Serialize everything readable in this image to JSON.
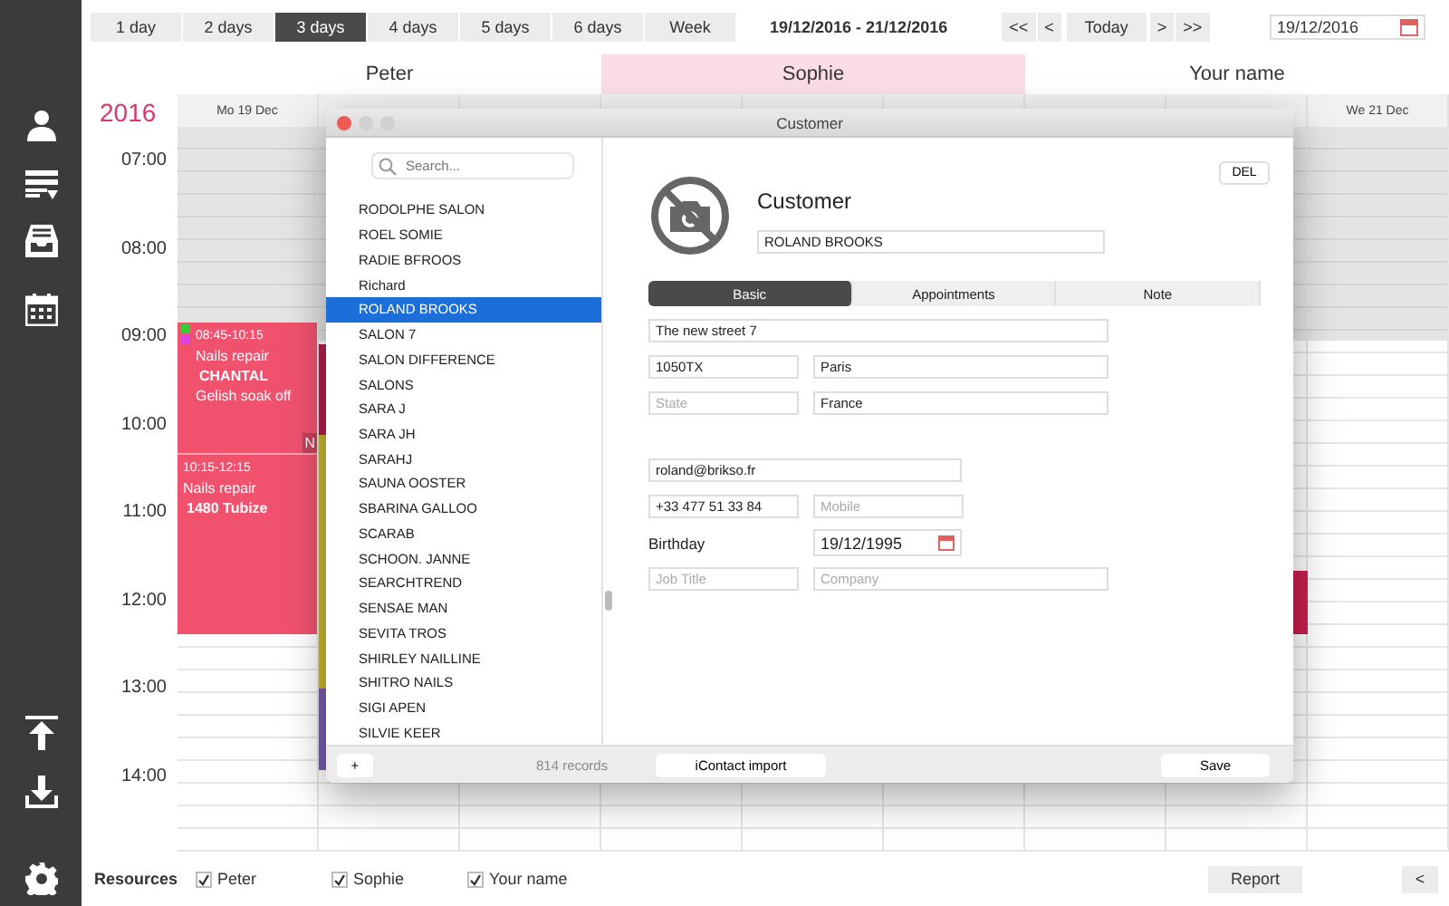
{
  "toolbar": {
    "ranges": [
      {
        "label": "1 day",
        "selected": false
      },
      {
        "label": "2 days",
        "selected": false
      },
      {
        "label": "3 days",
        "selected": true
      },
      {
        "label": "4 days",
        "selected": false
      },
      {
        "label": "5 days",
        "selected": false
      },
      {
        "label": "6 days",
        "selected": false
      },
      {
        "label": "Week",
        "selected": false
      }
    ],
    "date_range": "19/12/2016 - 21/12/2016",
    "nav": [
      "<<",
      "<",
      "Today",
      ">",
      ">>"
    ],
    "date_field": {
      "value": "19/12/2016"
    }
  },
  "calendar": {
    "year": "2016",
    "resources": [
      {
        "name": "Peter",
        "selected": false
      },
      {
        "name": "Sophie",
        "selected": true
      },
      {
        "name": "Your name",
        "selected": false
      }
    ],
    "day_headers": [
      "Mo 19 Dec",
      "We 21 Dec"
    ],
    "times": [
      "07:00",
      "08:00",
      "09:00",
      "10:00",
      "11:00",
      "12:00",
      "13:00",
      "14:00"
    ],
    "events": [
      {
        "time": "08:45-10:15",
        "service": "Nails repair",
        "client": "CHANTAL",
        "note": "Gelish soak off",
        "corner": "N",
        "markers": [
          {
            "color": "#33cc33"
          },
          {
            "color": "#e040e0"
          }
        ]
      },
      {
        "time": "10:15-12:15",
        "service": "Nails repair",
        "client": "1480 Tubize"
      }
    ]
  },
  "dialog": {
    "title": "Customer",
    "search": {
      "placeholder": "Search..."
    },
    "customers": [
      {
        "name": "RODOLPHE SALON",
        "selected": false
      },
      {
        "name": "ROEL SOMIE",
        "selected": false
      },
      {
        "name": "RADIE BFROOS",
        "selected": false
      },
      {
        "name": "Richard",
        "selected": false
      },
      {
        "name": "ROLAND BROOKS",
        "selected": true
      },
      {
        "name": "SALON 7",
        "selected": false
      },
      {
        "name": "SALON DIFFERENCE",
        "selected": false
      },
      {
        "name": "SALONS",
        "selected": false
      },
      {
        "name": "SARA J",
        "selected": false
      },
      {
        "name": "SARA JH",
        "selected": false
      },
      {
        "name": "SARAHJ",
        "selected": false
      },
      {
        "name": "SAUNA OOSTER",
        "selected": false
      },
      {
        "name": "SBARINA GALLOO",
        "selected": false
      },
      {
        "name": "SCARAB",
        "selected": false
      },
      {
        "name": "SCHOON. JANNE",
        "selected": false
      },
      {
        "name": "SEARCHTREND",
        "selected": false
      },
      {
        "name": "SENSAE MAN",
        "selected": false
      },
      {
        "name": "SEVITA TROS",
        "selected": false
      },
      {
        "name": "SHIRLEY NAILLINE",
        "selected": false
      },
      {
        "name": "SHITRO NAILS",
        "selected": false
      },
      {
        "name": "SIGI APEN",
        "selected": false
      },
      {
        "name": "SILVIE KEER",
        "selected": false
      }
    ],
    "delete_button": "DEL",
    "heading": "Customer",
    "name_field": {
      "value": "ROLAND BROOKS"
    },
    "tabs": [
      {
        "label": "Basic",
        "selected": true
      },
      {
        "label": "Appointments",
        "selected": false
      },
      {
        "label": "Note",
        "selected": false
      }
    ],
    "address": {
      "value": "The new street 7"
    },
    "postcode": {
      "value": "1050TX"
    },
    "city": {
      "value": "Paris"
    },
    "state": {
      "placeholder": "State"
    },
    "country": {
      "value": "France"
    },
    "email": {
      "value": "roland@brikso.fr"
    },
    "phone": {
      "value": "+33 477 51 33 84"
    },
    "mobile": {
      "placeholder": "Mobile"
    },
    "birthday": {
      "label": "Birthday",
      "value": "19/12/1995"
    },
    "job_title": {
      "placeholder": "Job Title"
    },
    "company": {
      "placeholder": "Company"
    },
    "add_button": "+",
    "record_count": "814 records",
    "import_button": "iContact import",
    "save_button": "Save"
  },
  "footer": {
    "label": "Resources",
    "resources": [
      {
        "name": "Peter",
        "checked": true
      },
      {
        "name": "Sophie",
        "checked": true
      },
      {
        "name": "Your name",
        "checked": true
      }
    ],
    "report_button": "Report",
    "collapse_button": "<"
  }
}
